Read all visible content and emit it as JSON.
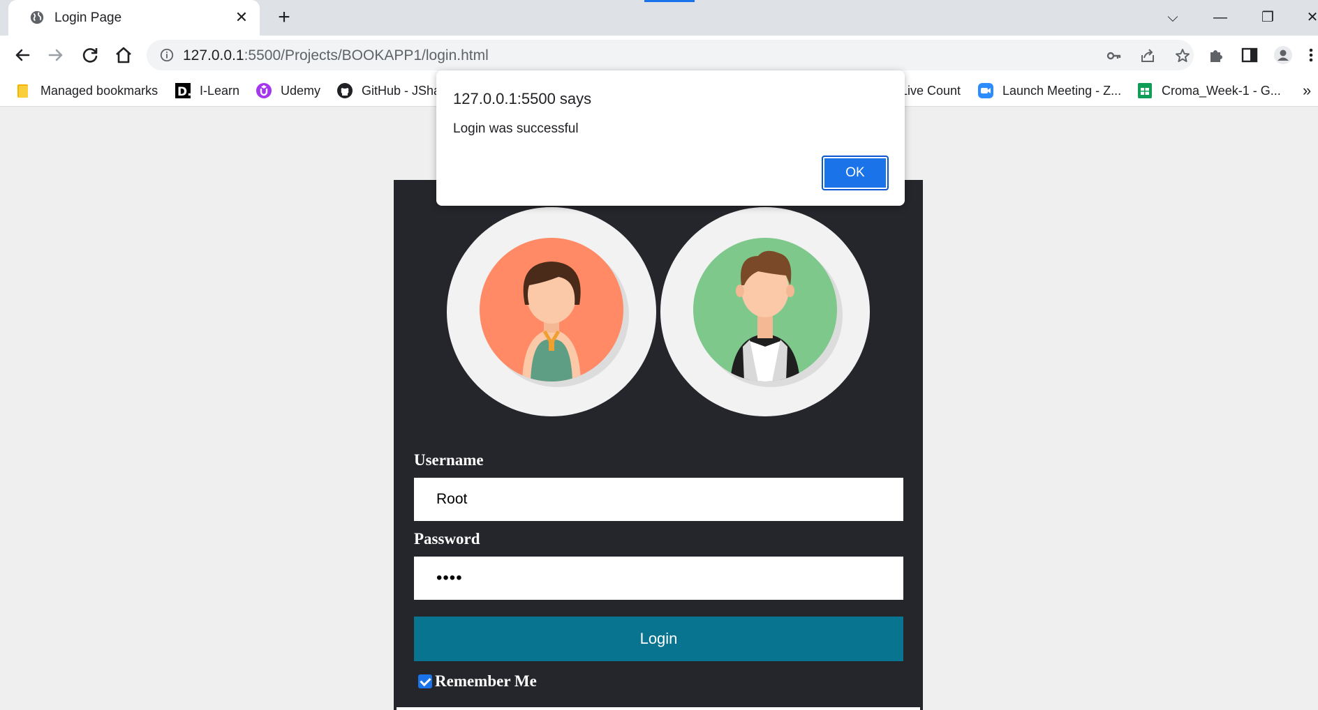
{
  "browser": {
    "tab_title": "Login Page",
    "tab_close": "✕",
    "new_tab": "+",
    "url_host": "127.0.0.1",
    "url_rest": ":5500/Projects/BOOKAPP1/login.html",
    "window_controls": {
      "dropdown": "⌵",
      "minimize": "—",
      "restore": "❐",
      "close": "✕"
    },
    "bookmarks": [
      {
        "label": "Managed bookmarks",
        "icon": "folder-icon",
        "color": "#f4b400"
      },
      {
        "label": "I-Learn",
        "icon": "d-logo-icon",
        "color": "#000000"
      },
      {
        "label": "Udemy",
        "icon": "udemy-icon",
        "color": "#a435f0"
      },
      {
        "label": "GitHub - JSha",
        "icon": "github-icon",
        "color": "#202124"
      },
      {
        "label": "Live Count",
        "icon": "",
        "color": ""
      },
      {
        "label": "Launch Meeting - Z...",
        "icon": "zoom-icon",
        "color": "#2d8cff"
      },
      {
        "label": "Croma_Week-1 - G...",
        "icon": "sheets-icon",
        "color": "#0f9d58"
      }
    ],
    "bookmarks_overflow": "»"
  },
  "dialog": {
    "title": "127.0.0.1:5500 says",
    "message": "Login was successful",
    "ok_label": "OK"
  },
  "login_form": {
    "username_label": "Username",
    "username_value": "Root",
    "password_label": "Password",
    "password_value": "••••",
    "login_button": "Login",
    "remember_label": "Remember Me",
    "remember_checked": true
  },
  "colors": {
    "card_bg": "#25262b",
    "button_bg": "#08748f",
    "accent": "#1a73e8",
    "female_avatar_bg": "#ff8a65",
    "male_avatar_bg": "#7ec88c"
  }
}
